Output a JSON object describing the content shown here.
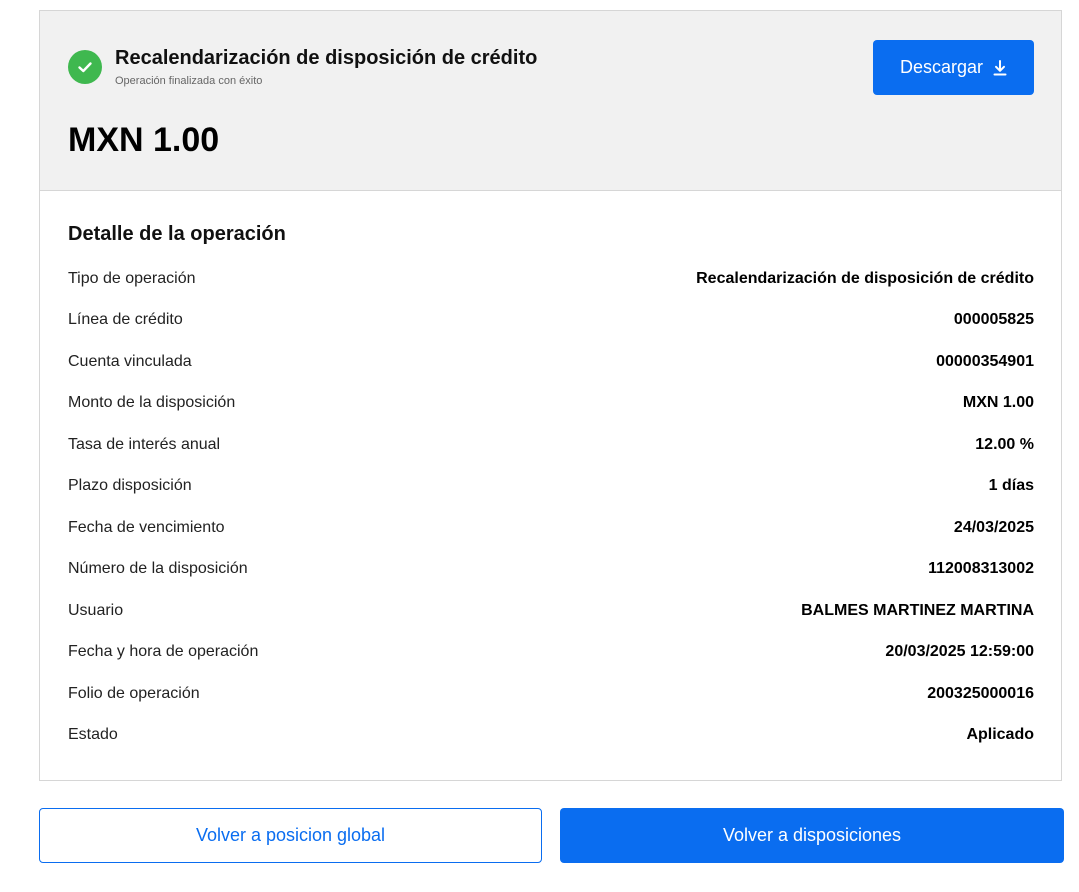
{
  "header": {
    "title": "Recalendarización de disposición de crédito",
    "subtitle": "Operación finalizada con éxito",
    "amount": "MXN 1.00",
    "download_label": "Descargar",
    "status_icon": "check-circle-icon",
    "download_icon": "download-icon"
  },
  "detail": {
    "title": "Detalle de la operación",
    "rows": [
      {
        "label": "Tipo de operación",
        "value": "Recalendarización de disposición de crédito"
      },
      {
        "label": "Línea de crédito",
        "value": "000005825"
      },
      {
        "label": "Cuenta vinculada",
        "value": "00000354901"
      },
      {
        "label": "Monto de la disposición",
        "value": "MXN 1.00"
      },
      {
        "label": "Tasa de interés anual",
        "value": "12.00 %"
      },
      {
        "label": "Plazo disposición",
        "value": "1 días"
      },
      {
        "label": "Fecha de vencimiento",
        "value": "24/03/2025"
      },
      {
        "label": "Número de la disposición",
        "value": "112008313002"
      },
      {
        "label": "Usuario",
        "value": "BALMES MARTINEZ MARTINA"
      },
      {
        "label": "Fecha y hora de operación",
        "value": "20/03/2025 12:59:00"
      },
      {
        "label": "Folio de operación",
        "value": "200325000016"
      },
      {
        "label": "Estado",
        "value": "Aplicado"
      }
    ]
  },
  "actions": {
    "secondary_label": "Volver a posicion global",
    "primary_label": "Volver a disposiciones"
  },
  "colors": {
    "accent": "#0a6df0",
    "success": "#3fb84f",
    "header_background": "#f1f1f1"
  }
}
